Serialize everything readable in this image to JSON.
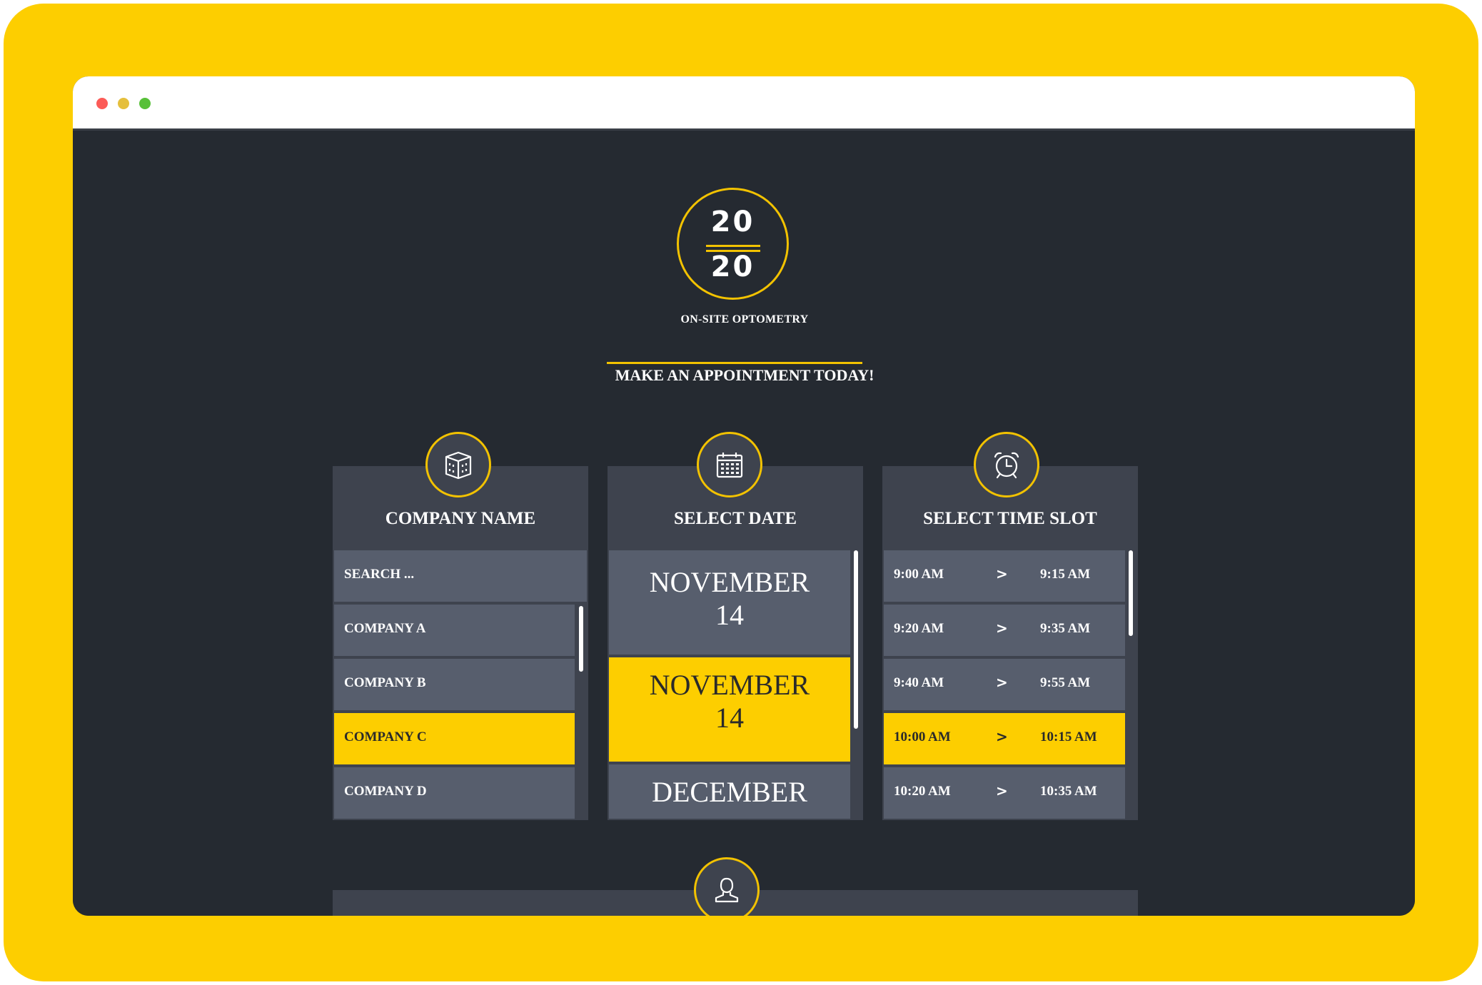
{
  "brand": {
    "logo_top": "20",
    "logo_bottom": "20",
    "tagline": "ON-SITE OPTOMETRY",
    "cta": "MAKE AN APPOINTMENT TODAY!",
    "accent_color": "#fdce00",
    "background_color": "#252a31"
  },
  "company_panel": {
    "icon": "building-icon",
    "title": "COMPANY NAME",
    "search_placeholder": "SEARCH ...",
    "items": [
      {
        "label": "COMPANY A",
        "selected": false
      },
      {
        "label": "COMPANY B",
        "selected": false
      },
      {
        "label": "COMPANY C",
        "selected": true
      },
      {
        "label": "COMPANY D",
        "selected": false
      }
    ]
  },
  "date_panel": {
    "icon": "calendar-icon",
    "title": "SELECT DATE",
    "items": [
      {
        "month": "NOVEMBER",
        "day": "14",
        "selected": false
      },
      {
        "month": "NOVEMBER",
        "day": "14",
        "selected": true
      },
      {
        "month": "DECEMBER",
        "day": "",
        "selected": false
      }
    ]
  },
  "time_panel": {
    "icon": "alarm-clock-icon",
    "title": "SELECT TIME SLOT",
    "slots": [
      {
        "start": "9:00 AM",
        "end": "9:15 AM",
        "selected": false
      },
      {
        "start": "9:20 AM",
        "end": "9:35 AM",
        "selected": false
      },
      {
        "start": "9:40 AM",
        "end": "9:55 AM",
        "selected": false
      },
      {
        "start": "10:00 AM",
        "end": "10:15 AM",
        "selected": true
      },
      {
        "start": "10:20 AM",
        "end": "10:35 AM",
        "selected": false
      }
    ],
    "arrow": ">"
  },
  "contact_section": {
    "icon": "user-icon"
  }
}
